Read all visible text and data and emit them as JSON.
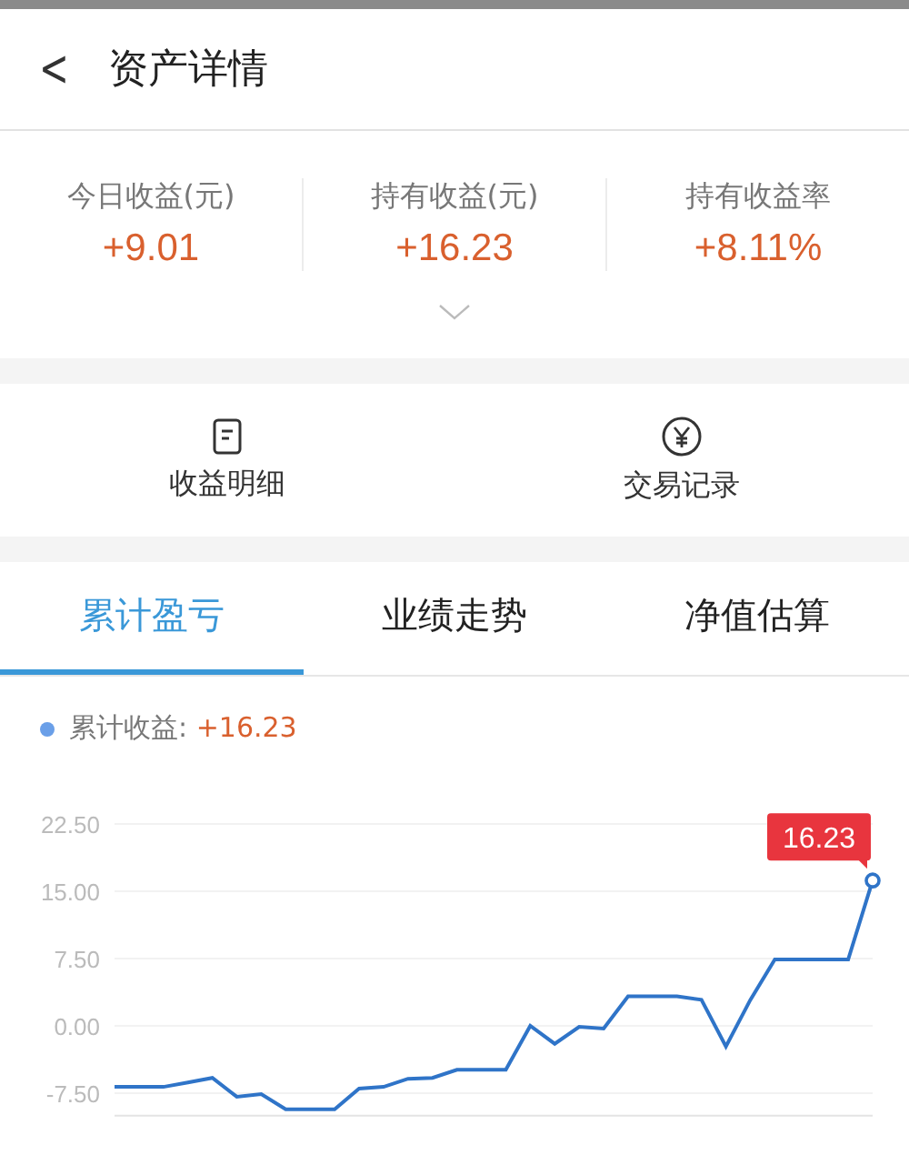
{
  "header": {
    "back": "<",
    "title": "资产详情"
  },
  "stats": [
    {
      "label": "今日收益(元)",
      "value": "+9.01"
    },
    {
      "label": "持有收益(元)",
      "value": "+16.23"
    },
    {
      "label": "持有收益率",
      "value": "+8.11%"
    }
  ],
  "actions": [
    {
      "kind": "document",
      "label": "收益明细"
    },
    {
      "kind": "yen",
      "label": "交易记录"
    }
  ],
  "tabs": [
    {
      "label": "累计盈亏",
      "selected": true
    },
    {
      "label": "业绩走势",
      "selected": false
    },
    {
      "label": "净值估算",
      "selected": false
    }
  ],
  "legend": {
    "label": "累计收益:",
    "value": "+16.23",
    "color": "#6a9fe8"
  },
  "chart_data": {
    "type": "line",
    "grid": true,
    "ylim": [
      -10,
      22.5
    ],
    "yticks": [
      {
        "value": 22.5,
        "label": "22.50"
      },
      {
        "value": 15,
        "label": "15.00"
      },
      {
        "value": 7.5,
        "label": "7.50"
      },
      {
        "value": 0,
        "label": "0.00"
      },
      {
        "value": -7.5,
        "label": "-7.50"
      }
    ],
    "series": [
      {
        "color": "#2f74c8",
        "values": [
          -6.8,
          -6.8,
          -6.8,
          -6.3,
          -5.8,
          -7.9,
          -7.6,
          -9.3,
          -9.3,
          -9.3,
          -7.0,
          -6.8,
          -5.9,
          -5.8,
          -4.9,
          -4.9,
          -4.9,
          0,
          -2.0,
          -0.1,
          -0.3,
          3.3,
          3.3,
          3.3,
          2.9,
          -2.3,
          2.9,
          7.4,
          7.4,
          7.4,
          7.4,
          16.2
        ]
      }
    ],
    "annotations": [
      "16.23"
    ]
  }
}
